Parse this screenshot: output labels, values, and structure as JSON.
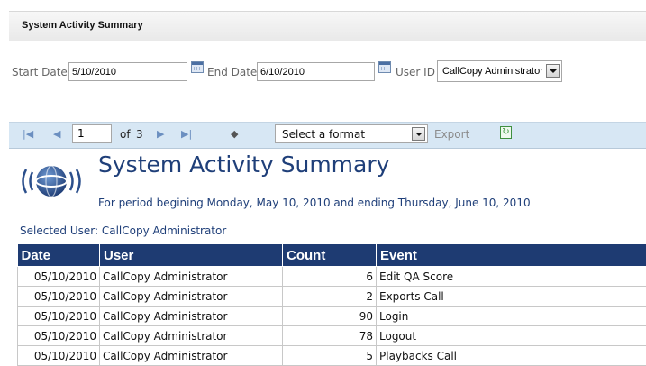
{
  "header": {
    "title": "System Activity Summary"
  },
  "params": {
    "start_label": "Start Date",
    "start_value": "5/10/2010",
    "end_label": "End Date",
    "end_value": "6/10/2010",
    "user_label": "User ID",
    "user_value": "CallCopy Administrator"
  },
  "toolbar": {
    "page_value": "1",
    "of_label": "of",
    "total_pages": "3",
    "format_value": "Select a format",
    "export_label": "Export"
  },
  "report": {
    "title": "System Activity Summary",
    "period": "For period begining Monday, May 10, 2010 and ending Thursday, June 10, 2010",
    "selected_user": "Selected User: CallCopy Administrator",
    "columns": [
      "Date",
      "User",
      "Count",
      "Event"
    ],
    "rows": [
      {
        "date": "05/10/2010",
        "user": "CallCopy Administrator",
        "count": "6",
        "event": "Edit QA Score"
      },
      {
        "date": "05/10/2010",
        "user": "CallCopy Administrator",
        "count": "2",
        "event": "Exports Call"
      },
      {
        "date": "05/10/2010",
        "user": "CallCopy Administrator",
        "count": "90",
        "event": "Login"
      },
      {
        "date": "05/10/2010",
        "user": "CallCopy Administrator",
        "count": "78",
        "event": "Logout"
      },
      {
        "date": "05/10/2010",
        "user": "CallCopy Administrator",
        "count": "5",
        "event": "Playbacks Call"
      }
    ]
  },
  "colors": {
    "header_blue": "#1e3b72",
    "title_blue": "#1f3f79",
    "toolbar_bg": "#d7e7f4"
  }
}
